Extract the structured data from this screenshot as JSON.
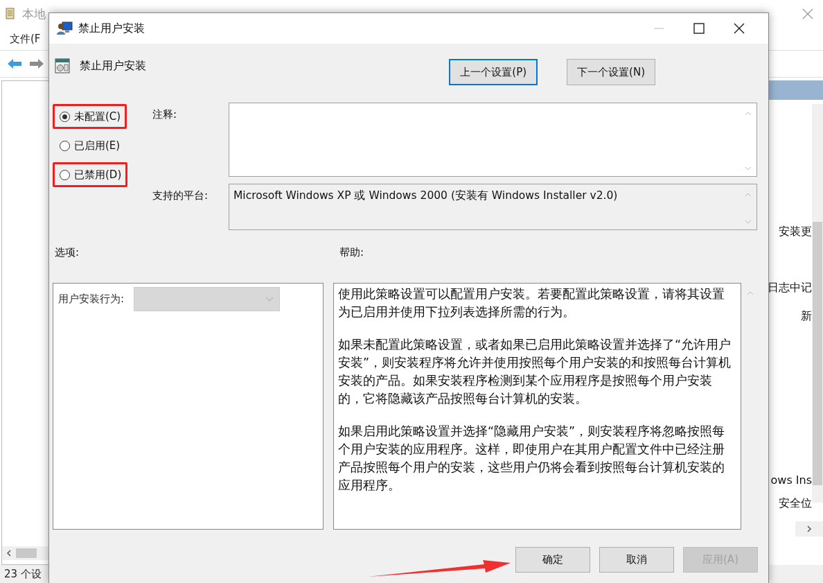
{
  "background_window": {
    "title": "本地",
    "menu": [
      "文件(F"
    ],
    "right_texts": [
      "安装更",
      "日志中记",
      "新",
      "ows Ins",
      "安全位"
    ],
    "status_bar": "23 个设"
  },
  "dialog": {
    "title": "禁止用户安装",
    "setting_name": "禁止用户安装",
    "nav_buttons": [
      {
        "label": "上一个设置(P)",
        "focused": true
      },
      {
        "label": "下一个设置(N)",
        "focused": false
      }
    ],
    "states": [
      {
        "label": "未配置(C)",
        "selected": true,
        "highlighted": true
      },
      {
        "label": "已启用(E)",
        "selected": false,
        "highlighted": false
      },
      {
        "label": "已禁用(D)",
        "selected": false,
        "highlighted": true
      }
    ],
    "comment_label": "注释:",
    "platform_label": "支持的平台:",
    "platform": "Microsoft Windows XP 或 Windows 2000 (安装有 Windows Installer v2.0)",
    "options_label": "选项:",
    "help_label": "帮助:",
    "options": [
      {
        "label": "用户安装行为:",
        "disabled": true
      }
    ],
    "help": [
      "使用此策略设置可以配置用户安装。若要配置此策略设置，请将其设置为已启用并使用下拉列表选择所需的行为。",
      "如果未配置此策略设置，或者如果已启用此策略设置并选择了“允许用户安装”，则安装程序将允许并使用按照每个用户安装的和按照每台计算机安装的产品。如果安装程序检测到某个应用程序是按照每个用户安装的，它将隐藏该产品按照每台计算机的安装。",
      "如果启用此策略设置并选择“隐藏用户安装”，则安装程序将忽略按照每个用户安装的应用程序。这样，即使用户在其用户配置文件中已经注册产品按照每个用户的安装，这些用户仍将会看到按照每台计算机安装的应用程序。"
    ],
    "buttons": [
      {
        "label": "确定",
        "disabled": false,
        "highlighted": true
      },
      {
        "label": "取消",
        "disabled": false,
        "highlighted": false
      },
      {
        "label": "应用(A)",
        "disabled": true,
        "highlighted": false
      }
    ]
  }
}
